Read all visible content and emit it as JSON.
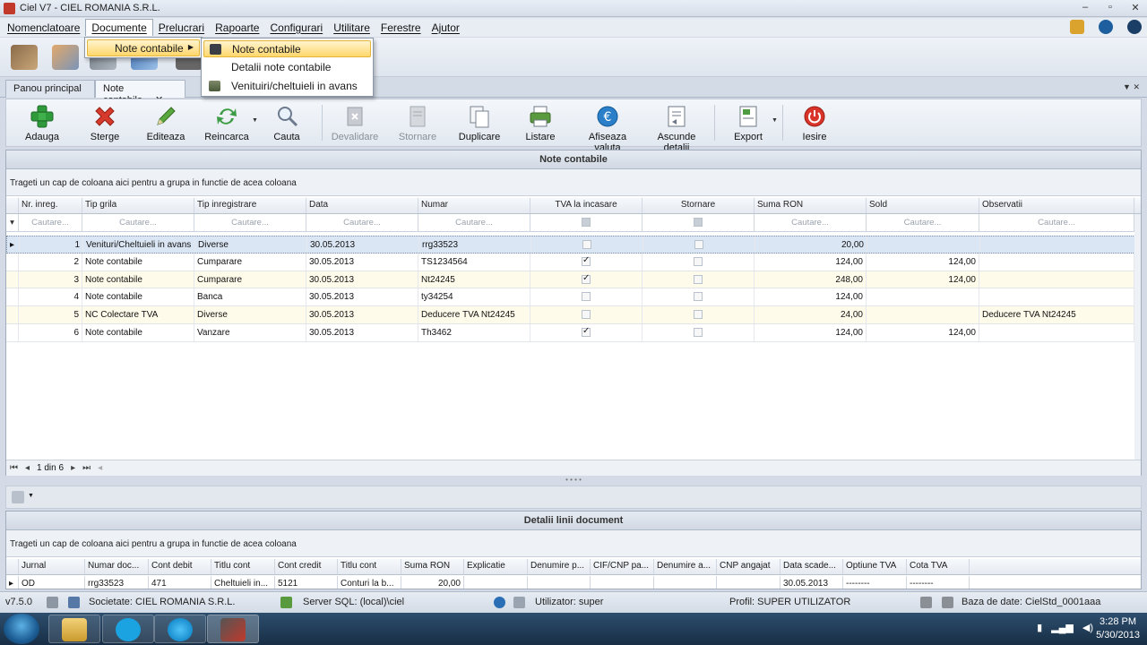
{
  "window": {
    "title": "Ciel V7 - CIEL ROMANIA S.R.L.",
    "controls": [
      "–",
      "▫",
      "✕"
    ]
  },
  "menubar": [
    "Nomenclatoare",
    "Documente",
    "Prelucrari",
    "Rapoarte",
    "Configurari",
    "Utilitare",
    "Ferestre",
    "Ajutor"
  ],
  "tabs": {
    "home": "Panou principal",
    "active": "Note contabile",
    "close": "✕",
    "arrows": "▼ ✕"
  },
  "menus": {
    "documente_item": "Note contabile",
    "submenu": [
      "Note contabile",
      "Detalii note contabile",
      "Venituiri/cheltuieli in avans"
    ]
  },
  "ribbon": {
    "add": "Adauga",
    "delete": "Sterge",
    "edit": "Editeaza",
    "reload": "Reincarca",
    "search": "Cauta",
    "invalidate": "Devalidare",
    "reverse": "Stornare",
    "duplicate": "Duplicare",
    "print": "Listare",
    "currency": "Afiseaza valuta",
    "hide_details": "Ascunde detalii",
    "export": "Export",
    "exit": "Iesire"
  },
  "panel_title": "Note contabile",
  "group_hint": "Trageti un cap de coloana aici pentru a grupa in functie de acea coloana",
  "columns": [
    "Nr. inreg.",
    "Tip grila",
    "Tip inregistrare",
    "Data",
    "Numar",
    "TVA la incasare",
    "Stornare",
    "Suma RON",
    "Sold",
    "Observatii"
  ],
  "filter_placeholder": "Cautare...",
  "rows": [
    {
      "nr": "1",
      "grila": "Venituri/Cheltuieli in avans",
      "tip": "Diverse",
      "data": "30.05.2013",
      "numar": "rrg33523",
      "tva": false,
      "storno": false,
      "suma": "20,00",
      "sold": "",
      "obs": ""
    },
    {
      "nr": "2",
      "grila": "Note contabile",
      "tip": "Cumparare",
      "data": "30.05.2013",
      "numar": "TS1234564",
      "tva": true,
      "storno": false,
      "suma": "124,00",
      "sold": "124,00",
      "obs": ""
    },
    {
      "nr": "3",
      "grila": "Note contabile",
      "tip": "Cumparare",
      "data": "30.05.2013",
      "numar": "Nt24245",
      "tva": true,
      "storno": false,
      "suma": "248,00",
      "sold": "124,00",
      "obs": ""
    },
    {
      "nr": "4",
      "grila": "Note contabile",
      "tip": "Banca",
      "data": "30.05.2013",
      "numar": "ty34254",
      "tva": false,
      "storno": false,
      "suma": "124,00",
      "sold": "",
      "obs": ""
    },
    {
      "nr": "5",
      "grila": "NC Colectare TVA",
      "tip": "Diverse",
      "data": "30.05.2013",
      "numar": "Deducere TVA Nt24245",
      "tva": false,
      "storno": false,
      "suma": "24,00",
      "sold": "",
      "obs": "Deducere TVA Nt24245"
    },
    {
      "nr": "6",
      "grila": "Note contabile",
      "tip": "Vanzare",
      "data": "30.05.2013",
      "numar": "Th3462",
      "tva": true,
      "storno": false,
      "suma": "124,00",
      "sold": "124,00",
      "obs": ""
    }
  ],
  "pager": {
    "text": "1 din 6"
  },
  "details": {
    "title": "Detalii linii document",
    "group_hint": "Trageti un cap de coloana aici pentru a grupa in functie de acea coloana",
    "columns": [
      "Jurnal",
      "Numar doc...",
      "Cont debit",
      "Titlu cont",
      "Cont credit",
      "Titlu cont",
      "Suma RON",
      "Explicatie",
      "Denumire p...",
      "CIF/CNP pa...",
      "Denumire a...",
      "CNP angajat",
      "Data scade...",
      "Optiune TVA",
      "Cota TVA"
    ],
    "row": [
      "OD",
      "rrg33523",
      "471",
      "Cheltuieli in...",
      "5121",
      "Conturi la b...",
      "20,00",
      "",
      "",
      "",
      "",
      "",
      "30.05.2013",
      "--------",
      "--------"
    ]
  },
  "statusbar": {
    "version": "v7.5.0",
    "company": "Societate: CIEL ROMANIA S.R.L.",
    "server": "Server SQL: (local)\\ciel",
    "user": "Utilizator: super",
    "profile": "Profil: SUPER UTILIZATOR",
    "db": "Baza de date: CielStd_0001aaa"
  },
  "taskbar": {
    "time": "3:28 PM",
    "date": "5/30/2013"
  },
  "colors": {
    "accent": "#ffd76b",
    "selected_row": "#dbe6f4",
    "alt_row": "#fffbea"
  }
}
